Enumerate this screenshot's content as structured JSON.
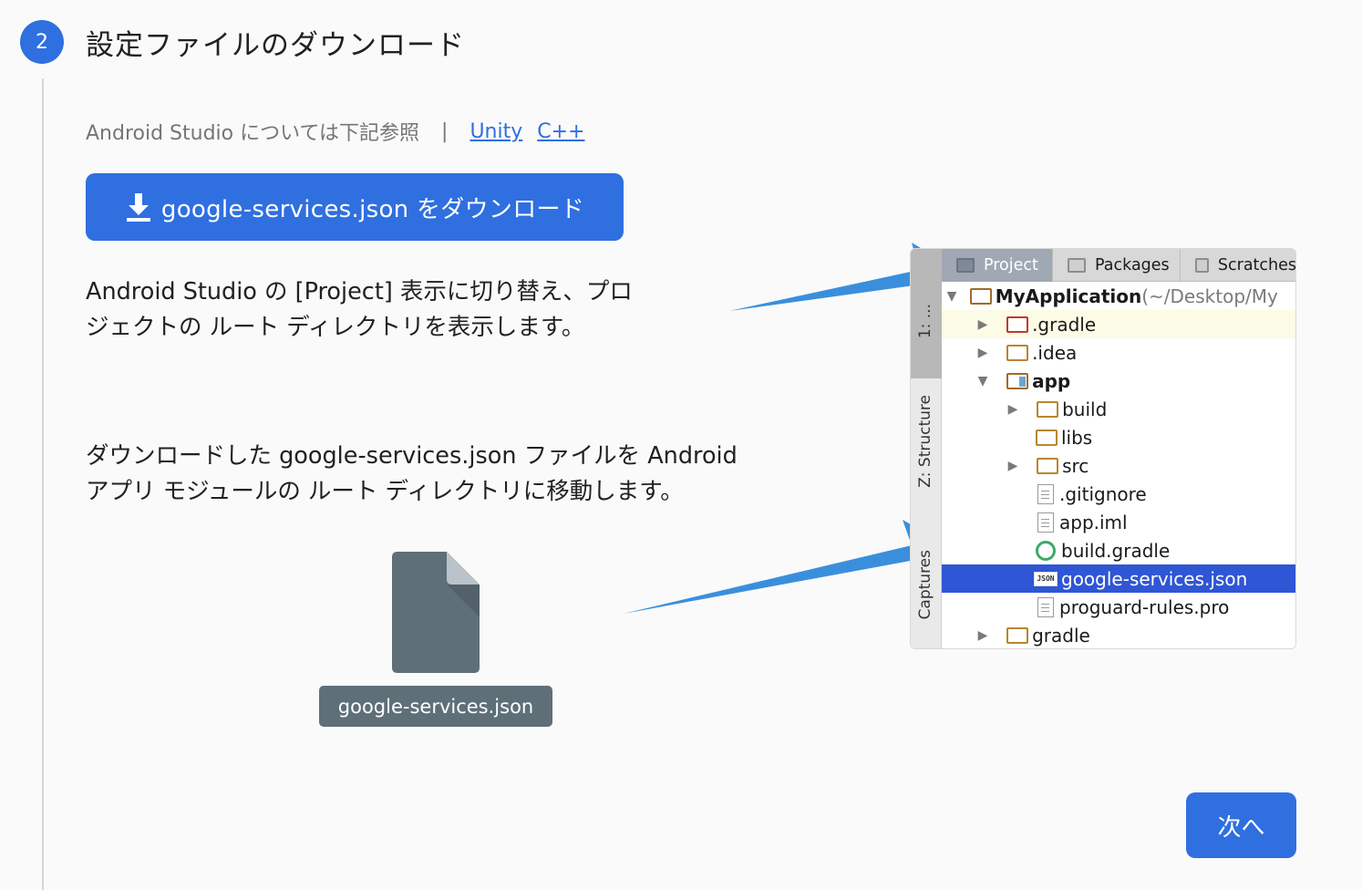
{
  "step": {
    "number": "2",
    "title": "設定ファイルのダウンロード"
  },
  "links": {
    "intro": "Android Studio については下記参照",
    "separator": "|",
    "unity": "Unity",
    "cpp": "C++"
  },
  "download_button": {
    "label": "google-services.json をダウンロード"
  },
  "instructions": {
    "p1_line1": "Android Studio の [Project] 表示に切り替え、プロ",
    "p1_line2": "ジェクトの ルート ディレクトリを表示します。",
    "p2_line1": "ダウンロードした google-services.json ファイルを Android",
    "p2_line2": "アプリ モジュールの ルート ディレクトリに移動します。"
  },
  "file": {
    "name": "google-services.json"
  },
  "ide": {
    "side_tabs": [
      "1: ...",
      "Z: Structure",
      "Captures"
    ],
    "tabs": [
      "Project",
      "Packages",
      "Scratches"
    ],
    "tree": {
      "root_name": "MyApplication",
      "root_path": " (~/Desktop/My",
      "gradle_dot": ".gradle",
      "idea": ".idea",
      "app": "app",
      "build": "build",
      "libs": "libs",
      "src": "src",
      "gitignore": ".gitignore",
      "app_iml": "app.iml",
      "build_gradle": "build.gradle",
      "json_badge": "JSON",
      "google_services": "google-services.json",
      "proguard": "proguard-rules.pro",
      "gradle": "gradle"
    }
  },
  "next_button": {
    "label": "次へ"
  },
  "colors": {
    "accent": "#2f6fe0",
    "selection": "#2f56d4",
    "arrow": "#3a8fdc"
  }
}
